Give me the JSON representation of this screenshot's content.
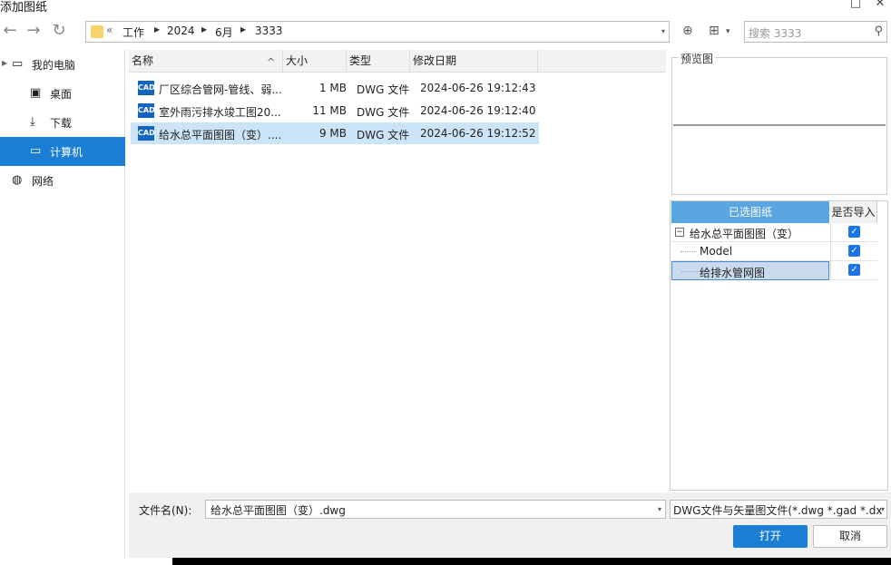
{
  "window": {
    "title": "添加图纸",
    "minimize_glyph": "□",
    "close_glyph": "✕"
  },
  "toolbar": {
    "back_icon": "←",
    "forward_icon": "→",
    "refresh_icon": "↻",
    "overflow": "«",
    "breadcrumbs": [
      "工作",
      "2024",
      "6月",
      "3333"
    ],
    "breadcrumb_sep": "▶",
    "dropdown_glyph": "▾",
    "new_folder_icon": "⊕",
    "view_icon": "⊞",
    "view_caret": "▾",
    "search_placeholder": "搜索 3333",
    "search_glyph": "⚲"
  },
  "sidebar": {
    "expand_glyph": "▶",
    "items": [
      {
        "label": "我的电脑",
        "icon": "▭",
        "icon_name": "computer-icon"
      },
      {
        "label": "桌面",
        "icon": "▣",
        "icon_name": "desktop-icon"
      },
      {
        "label": "下载",
        "icon": "⤓",
        "icon_name": "download-icon"
      },
      {
        "label": "计算机",
        "icon": "▭",
        "icon_name": "computer-icon",
        "active": true
      },
      {
        "label": "网络",
        "icon": "◍",
        "icon_name": "globe-icon"
      }
    ]
  },
  "filelist": {
    "columns": {
      "name": "名称",
      "size": "大小",
      "type": "类型",
      "date": "修改日期"
    },
    "sort_glyph": "^",
    "file_icon_text": "CAD",
    "rows": [
      {
        "name": "厂区综合管网-管线、弱...",
        "size": "1 MB",
        "type": "DWG 文件",
        "date": "2024-06-26 19:12:43"
      },
      {
        "name": "室外雨污排水竣工图20...",
        "size": "11 MB",
        "type": "DWG 文件",
        "date": "2024-06-26 19:12:40"
      },
      {
        "name": "给水总平面图图（变）....",
        "size": "9 MB",
        "type": "DWG 文件",
        "date": "2024-06-26 19:12:52",
        "selected": true
      }
    ]
  },
  "preview": {
    "label": "预览图"
  },
  "selected_drawings": {
    "header_main": "已选图纸",
    "header_import": "是否导入",
    "collapse_glyph": "−",
    "check_glyph": "✓",
    "items": [
      {
        "label": "给水总平面图图（变）",
        "checked": true
      },
      {
        "label": "Model",
        "checked": true
      },
      {
        "label": "给排水管网图",
        "checked": true
      }
    ]
  },
  "bottom": {
    "filename_label": "文件名(N):",
    "filename_value": "给水总平面图图（变）.dwg",
    "filter_value": "DWG文件与矢量图文件(*.dwg *.gad *.dx",
    "open_label": "打开",
    "cancel_label": "取消"
  },
  "colors": {
    "accent": "#1a7fd4",
    "selection": "#cce4f7",
    "header_blue": "#5aa6e0"
  }
}
